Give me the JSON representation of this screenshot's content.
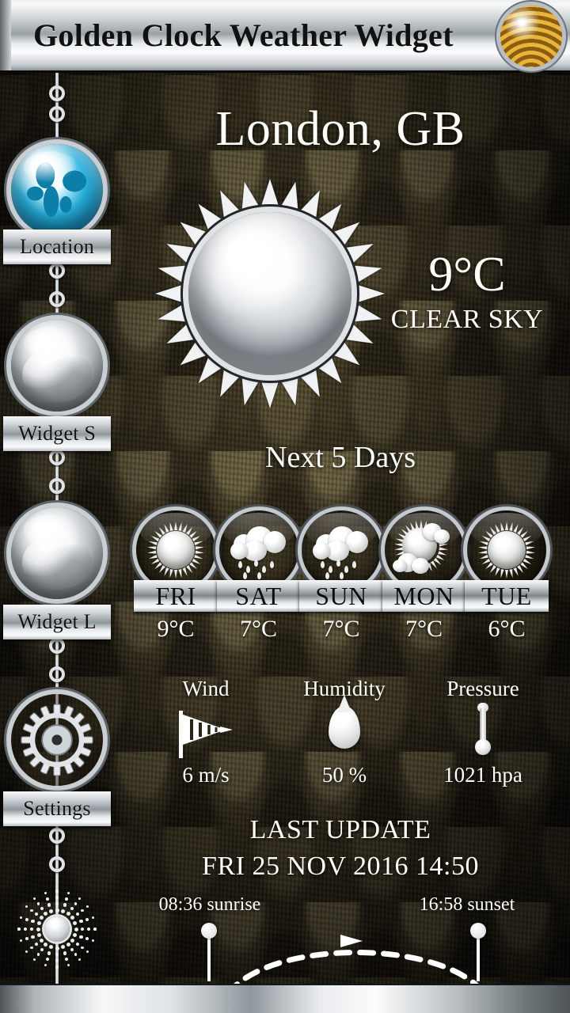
{
  "titlebar": {
    "title": "Golden Clock Weather Widget",
    "app_icon": "golden-wheat-icon"
  },
  "sidebar": {
    "items": [
      {
        "label": "Location",
        "icon": "globe-icon"
      },
      {
        "label": "Widget S",
        "icon": "sphere-icon"
      },
      {
        "label": "Widget L",
        "icon": "sphere-icon"
      },
      {
        "label": "Settings",
        "icon": "gear-icon"
      }
    ],
    "ornament": "sunburst-ornament"
  },
  "current": {
    "city": "London, GB",
    "icon": "sun-icon",
    "temperature": "9°C",
    "condition": "CLEAR SKY"
  },
  "forecast": {
    "heading": "Next 5 Days",
    "days": [
      {
        "day": "FRI",
        "temp": "9°C",
        "icon": "sun-icon"
      },
      {
        "day": "SAT",
        "temp": "7°C",
        "icon": "rain-icon"
      },
      {
        "day": "SUN",
        "temp": "7°C",
        "icon": "rain-icon"
      },
      {
        "day": "MON",
        "temp": "7°C",
        "icon": "sun-cloud-icon"
      },
      {
        "day": "TUE",
        "temp": "6°C",
        "icon": "sun-icon"
      }
    ]
  },
  "metrics": [
    {
      "label": "Wind",
      "value": "6 m/s",
      "icon": "windsock-icon"
    },
    {
      "label": "Humidity",
      "value": "50 %",
      "icon": "droplet-icon"
    },
    {
      "label": "Pressure",
      "value": "1021 hpa",
      "icon": "thermometer-icon"
    }
  ],
  "last_update": {
    "title": "LAST UPDATE",
    "datetime": "FRI 25 NOV 2016 14:50"
  },
  "sun_path": {
    "sunrise": "08:36 sunrise",
    "sunset": "16:58 sunset",
    "arc": "dashed-arc-arrow"
  },
  "colors": {
    "background_dark": "#2a2414",
    "background_light": "#6b6140",
    "chrome_light": "#fbfcfc",
    "chrome_mid": "#8f969b",
    "text_light": "#fffef8",
    "text_dark": "#111111",
    "gold": "#e8b53a"
  }
}
